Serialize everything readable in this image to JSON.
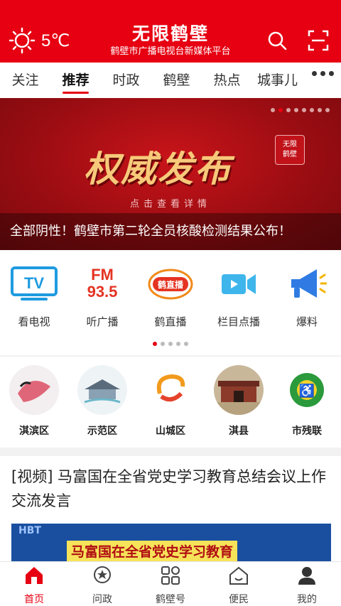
{
  "header": {
    "temperature": "5℃",
    "title": "无限鹤壁",
    "subtitle": "鹤壁市广播电视台新媒体平台",
    "colors": {
      "brand": "#e60012"
    }
  },
  "tabs": [
    {
      "label": "关注"
    },
    {
      "label": "推荐",
      "active": true
    },
    {
      "label": "时政"
    },
    {
      "label": "鹤壁"
    },
    {
      "label": "热点"
    },
    {
      "label": "城事儿"
    }
  ],
  "banner": {
    "headline": "权威发布",
    "hint": "点击查看详情",
    "badge_line1": "无限",
    "badge_line2": "鹤壁",
    "caption": "全部阴性！鹤壁市第二轮全员核酸检测结果公布！",
    "page_index": 2,
    "page_count": 8
  },
  "services": [
    {
      "label": "看电视",
      "icon": "tv-icon",
      "icon_text": "TV"
    },
    {
      "label": "听广播",
      "icon": "radio-fm-icon",
      "icon_text1": "FM",
      "icon_text2": "93.5"
    },
    {
      "label": "鹤直播",
      "icon": "live-icon",
      "icon_text": "鹤直播"
    },
    {
      "label": "栏目点播",
      "icon": "video-camera-icon"
    },
    {
      "label": "爆料",
      "icon": "megaphone-icon"
    }
  ],
  "districts": [
    {
      "label": "淇滨区"
    },
    {
      "label": "示范区"
    },
    {
      "label": "山城区"
    },
    {
      "label": "淇县"
    },
    {
      "label": "市残联"
    }
  ],
  "news": {
    "title": "[视频] 马富国在全省党史学习教育总结会议上作交流发言",
    "thumb_caption": "马富国在全省党史学习教育",
    "thumb_mark": "HBT"
  },
  "bottom_nav": [
    {
      "label": "首页",
      "icon": "home-icon",
      "active": true
    },
    {
      "label": "问政",
      "icon": "star-chat-icon"
    },
    {
      "label": "鹤壁号",
      "icon": "grid-icon"
    },
    {
      "label": "便民",
      "icon": "house-smile-icon"
    },
    {
      "label": "我的",
      "icon": "user-icon"
    }
  ]
}
